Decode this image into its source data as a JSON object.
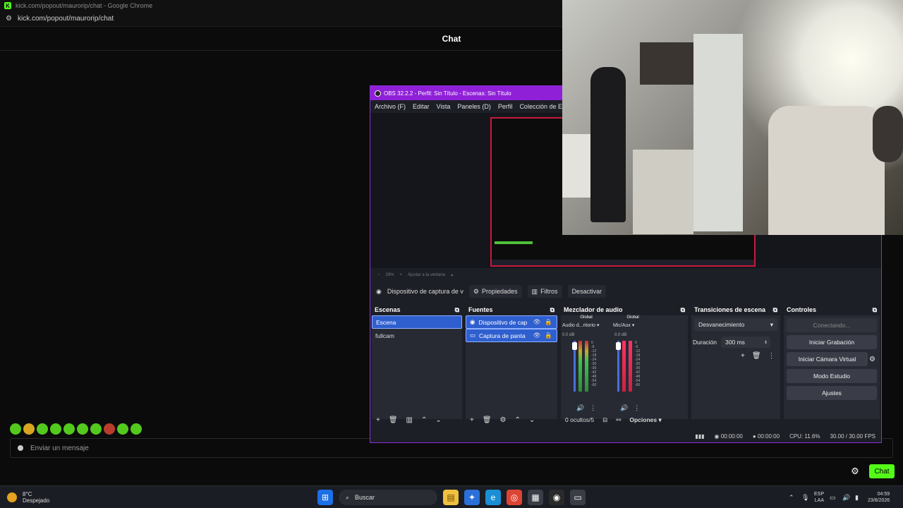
{
  "chrome": {
    "window_title": "kick.com/popout/maurorip/chat - Google Chrome",
    "url": "kick.com/popout/maurorip/chat",
    "chat_header": "Chat",
    "chat_input_placeholder": "Enviar un mensaje",
    "chat_send_label": "Chat"
  },
  "obs": {
    "title": "OBS 32.2.2 - Perfil: Sin Título - Escenas: Sin Título",
    "menu": [
      "Archivo (F)",
      "Editar",
      "Vista",
      "Paneles (D)",
      "Perfil",
      "Colección de Escen"
    ],
    "preview_footer": {
      "zoom": "29%",
      "fit_label": "Ajustar a la ventana"
    },
    "source_toolbar": {
      "selected_source": "Dispositivo de captura de v",
      "properties": "Propiedades",
      "filters": "Filtros",
      "deactivate": "Desactivar"
    },
    "scenes": {
      "header": "Escenas",
      "items": [
        {
          "label": "Escena",
          "selected": true
        },
        {
          "label": "fullcam",
          "selected": false
        }
      ]
    },
    "sources": {
      "header": "Fuentes",
      "items": [
        {
          "label": "Dispositivo de cap",
          "icon": "camera-icon"
        },
        {
          "label": "Captura de panta",
          "icon": "monitor-icon"
        }
      ]
    },
    "mixer": {
      "header": "Mezclador de audio",
      "channels": [
        {
          "tag": "Global",
          "name": "Audio d...ritorio",
          "db": "0.0 dB"
        },
        {
          "tag": "Global",
          "name": "Mic/Aux",
          "db": "0.0 dB"
        }
      ],
      "scale": [
        "0",
        "-6",
        "-12",
        "-18",
        "-24",
        "-30",
        "-36",
        "-42",
        "-48",
        "-54",
        "-60"
      ],
      "hidden": "0 ocultos/5",
      "options": "Opciones"
    },
    "transitions": {
      "header": "Transiciones de escena",
      "selected": "Desvanecimiento",
      "duration_label": "Duración",
      "duration_value": "300 ms"
    },
    "controls": {
      "header": "Controles",
      "connecting": "Conectando...",
      "start_recording": "Iniciar Grabación",
      "start_virtual_cam": "Iniciar Cámara Virtual",
      "studio_mode": "Modo Estudio",
      "settings": "Ajustes"
    },
    "status": {
      "stream_time": "00:00:00",
      "rec_time": "00:00:00",
      "cpu": "CPU: 11.6%",
      "fps": "30.00 / 30.00 FPS"
    }
  },
  "taskbar": {
    "temperature": "8°C",
    "weather": "Despejado",
    "search": "Buscar",
    "lang_top": "ESP",
    "lang_bottom": "LAA",
    "time": "04:59",
    "date": "23/8/2026"
  },
  "colors": {
    "kick_green": "#53fc18",
    "obs_purple": "#8f20d8",
    "selection_blue": "#2f5fcf"
  }
}
